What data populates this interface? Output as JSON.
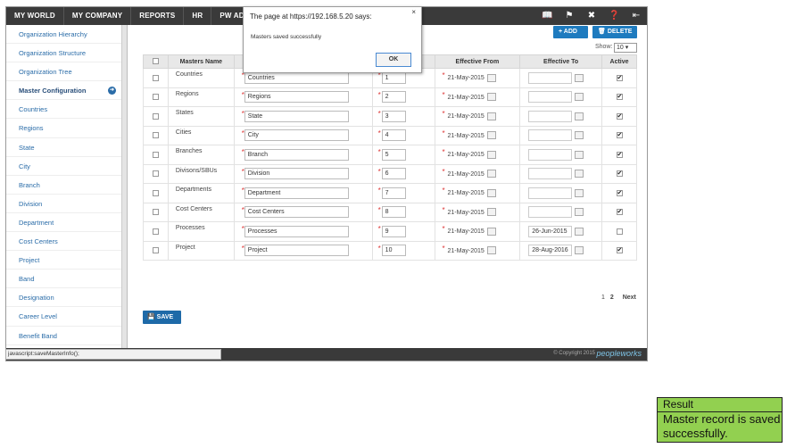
{
  "nav": {
    "items": [
      "MY WORLD",
      "MY COMPANY",
      "REPORTS",
      "HR",
      "PW ADMIN"
    ],
    "icons": [
      "book-icon",
      "flag-icon",
      "tools-icon",
      "help-icon",
      "logout-icon"
    ]
  },
  "sidebar": {
    "items": [
      {
        "label": "Organization Hierarchy"
      },
      {
        "label": "Organization Structure"
      },
      {
        "label": "Organization Tree"
      },
      {
        "label": "Master Configuration"
      },
      {
        "label": "Countries"
      },
      {
        "label": "Regions"
      },
      {
        "label": "State"
      },
      {
        "label": "City"
      },
      {
        "label": "Branch"
      },
      {
        "label": "Division"
      },
      {
        "label": "Department"
      },
      {
        "label": "Cost Centers"
      },
      {
        "label": "Project"
      },
      {
        "label": "Band"
      },
      {
        "label": "Designation"
      },
      {
        "label": "Career Level"
      },
      {
        "label": "Benefit Band"
      }
    ]
  },
  "toolbar": {
    "add_label": "+ ADD",
    "delete_label": "🗑 DELETE",
    "show_label": "Show:",
    "show_value": "10 ▾"
  },
  "table": {
    "headers": [
      "",
      "Masters Name",
      "",
      "",
      "Effective From",
      "Effective To",
      "Active"
    ],
    "rows": [
      {
        "name": "Countries",
        "display": "Countries",
        "seq": "1",
        "from": "21-May-2015",
        "to": "",
        "active": true
      },
      {
        "name": "Regions",
        "display": "Regions",
        "seq": "2",
        "from": "21-May-2015",
        "to": "",
        "active": true
      },
      {
        "name": "States",
        "display": "State",
        "seq": "3",
        "from": "21-May-2015",
        "to": "",
        "active": true
      },
      {
        "name": "Cities",
        "display": "City",
        "seq": "4",
        "from": "21-May-2015",
        "to": "",
        "active": true
      },
      {
        "name": "Branches",
        "display": "Branch",
        "seq": "5",
        "from": "21-May-2015",
        "to": "",
        "active": true
      },
      {
        "name": "Divisons/SBUs",
        "display": "Division",
        "seq": "6",
        "from": "21-May-2015",
        "to": "",
        "active": true
      },
      {
        "name": "Departments",
        "display": "Department",
        "seq": "7",
        "from": "21-May-2015",
        "to": "",
        "active": true
      },
      {
        "name": "Cost Centers",
        "display": "Cost Centers",
        "seq": "8",
        "from": "21-May-2015",
        "to": "",
        "active": true
      },
      {
        "name": "Processes",
        "display": "Processes",
        "seq": "9",
        "from": "21-May-2015",
        "to": "26-Jun-2015",
        "active": false
      },
      {
        "name": "Project",
        "display": "Project",
        "seq": "10",
        "from": "21-May-2015",
        "to": "28-Aug-2016",
        "active": true
      }
    ]
  },
  "pager": {
    "p1": "1",
    "p2": "2",
    "next": "Next"
  },
  "save_label": "SAVE",
  "footer": {
    "copyright": "© Copyright 2015",
    "brand": "peopleworks"
  },
  "statusbar": "javascript:saveMasterInfo();",
  "dialog": {
    "title": "The page at https://192.168.5.20 says:",
    "close": "×",
    "message": "Masters saved successfully",
    "ok": "OK"
  },
  "result": {
    "label": "Result",
    "value": "Master record is saved successfully."
  },
  "colors": {
    "nav": "#3a3a3a",
    "accent": "#1e7bbf",
    "result_bg": "#92d050"
  }
}
